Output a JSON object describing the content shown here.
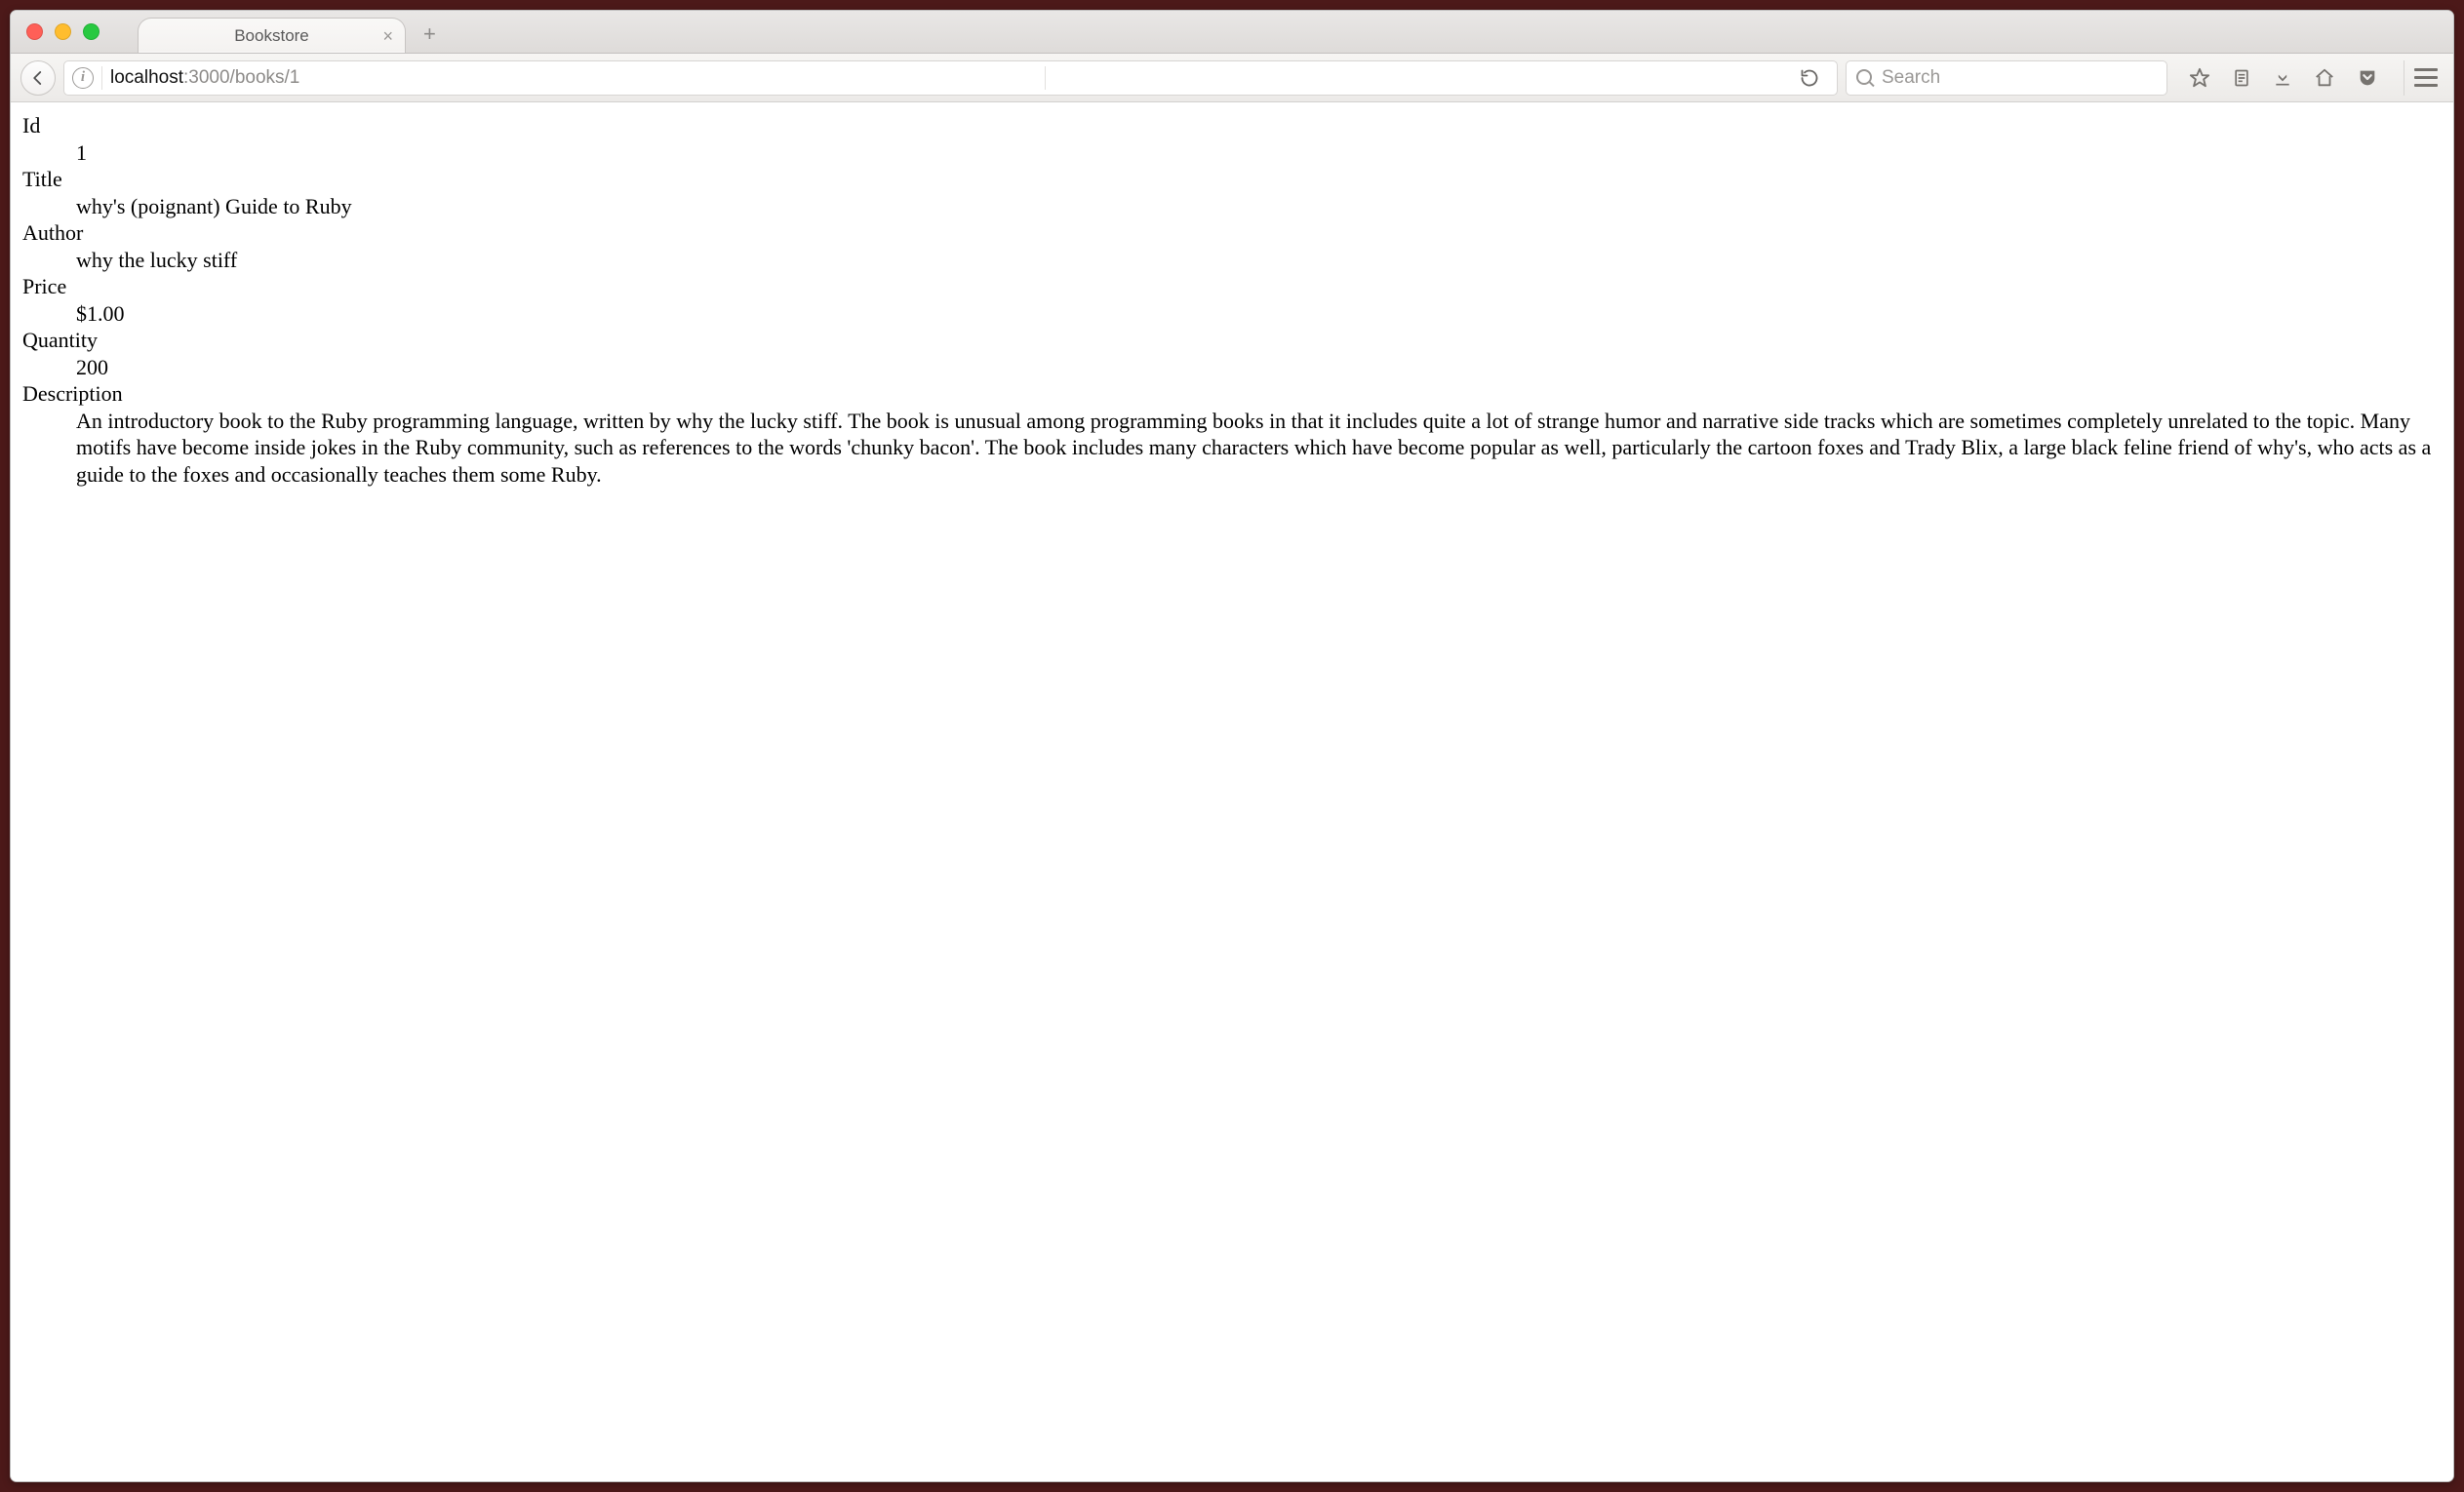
{
  "browser": {
    "tab_title": "Bookstore",
    "url_host": "localhost",
    "url_rest": ":3000/books/1",
    "search_placeholder": "Search"
  },
  "book": {
    "labels": {
      "id": "Id",
      "title": "Title",
      "author": "Author",
      "price": "Price",
      "quantity": "Quantity",
      "description": "Description"
    },
    "id": "1",
    "title": "why's (poignant) Guide to Ruby",
    "author": "why the lucky stiff",
    "price": "$1.00",
    "quantity": "200",
    "description": "An introductory book to the Ruby programming language, written by why the lucky stiff. The book is unusual among programming books in that it includes quite a lot of strange humor and narrative side tracks which are sometimes completely unrelated to the topic. Many motifs have become inside jokes in the Ruby community, such as references to the words 'chunky bacon'. The book includes many characters which have become popular as well, particularly the cartoon foxes and Trady Blix, a large black feline friend of why's, who acts as a guide to the foxes and occasionally teaches them some Ruby."
  }
}
